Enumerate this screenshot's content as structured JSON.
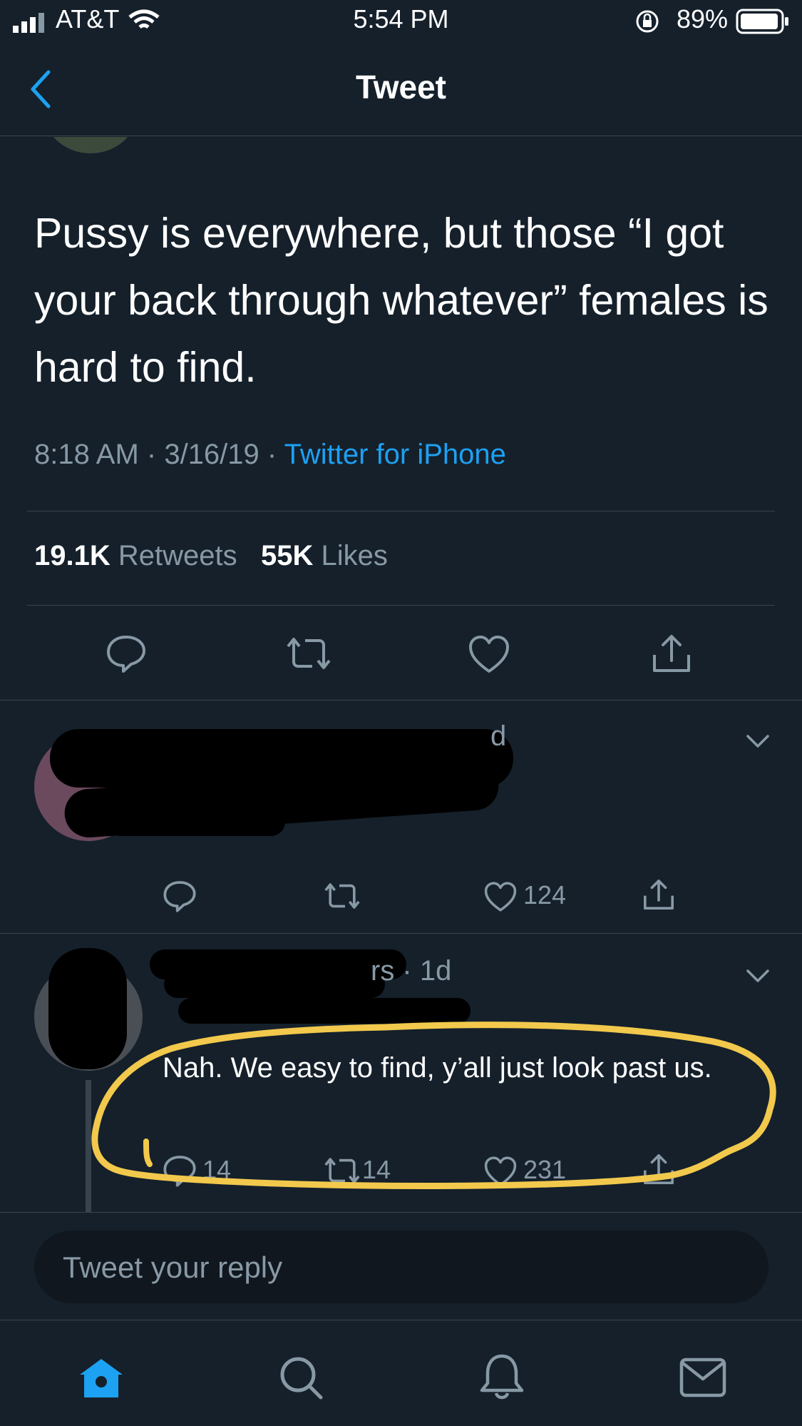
{
  "status_bar": {
    "carrier": "AT&T",
    "time": "5:54 PM",
    "battery": "89%"
  },
  "nav": {
    "title": "Tweet",
    "back_icon": "chevron-left-icon"
  },
  "tweet": {
    "text": "Pussy is everywhere, but those “I got your back through whatever” females is hard to find.",
    "time": "8:18 AM",
    "date": "3/16/19",
    "source": "Twitter for iPhone",
    "retweets": {
      "count": "19.1K",
      "label": "Retweets"
    },
    "likes": {
      "count": "55K",
      "label": "Likes"
    }
  },
  "replies": [
    {
      "time_fragment": "d",
      "like_count": "124"
    },
    {
      "time_fragment": "rs · 1d",
      "text": "Nah. We easy to find, y’all just look past us.",
      "reply_count": "14",
      "retweet_count": "14",
      "like_count": "231"
    }
  ],
  "composer": {
    "placeholder": "Tweet your reply"
  },
  "colors": {
    "background": "#15202b",
    "accent": "#1da1f2",
    "muted": "#8899a6",
    "divider": "#38444d",
    "highlight": "#f2c94c"
  },
  "tabbar": [
    "home-icon",
    "search-icon",
    "bell-icon",
    "mail-icon"
  ]
}
